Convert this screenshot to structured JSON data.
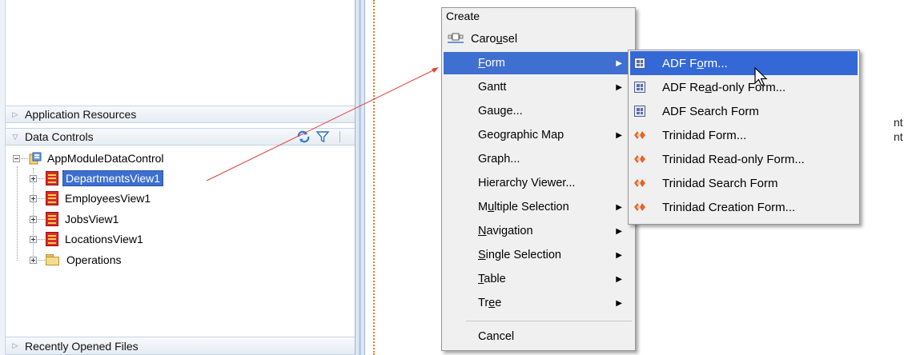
{
  "left_panel": {
    "accordions": {
      "application_resources": "Application Resources",
      "data_controls": "Data Controls",
      "recently_opened": "Recently Opened Files"
    },
    "tree": {
      "root": "AppModuleDataControl",
      "children": [
        {
          "label": "DepartmentsView1",
          "selected": true
        },
        {
          "label": "EmployeesView1"
        },
        {
          "label": "JobsView1"
        },
        {
          "label": "LocationsView1"
        },
        {
          "label": "Operations"
        }
      ]
    }
  },
  "background_text": {
    "line1": "nt on",
    "line2": "nt fron"
  },
  "create_menu": {
    "title": "Create",
    "items": [
      {
        "label": "Carousel"
      },
      {
        "label": "Form",
        "submenu": true,
        "active": true
      },
      {
        "label": "Gantt",
        "submenu": true
      },
      {
        "label": "Gauge..."
      },
      {
        "label": "Geographic Map",
        "submenu": true
      },
      {
        "label": "Graph..."
      },
      {
        "label": "Hierarchy Viewer..."
      },
      {
        "label": "Multiple Selection",
        "submenu": true
      },
      {
        "label": "Navigation",
        "submenu": true
      },
      {
        "label": "Single Selection",
        "submenu": true
      },
      {
        "label": "Table",
        "submenu": true
      },
      {
        "label": "Tree",
        "submenu": true
      },
      {
        "label": "Cancel"
      }
    ]
  },
  "form_submenu": {
    "items": [
      {
        "label": "ADF Form...",
        "icon": "adf-form-icon",
        "active": true
      },
      {
        "label": "ADF Read-only Form...",
        "icon": "adf-form-icon"
      },
      {
        "label": "ADF Search Form",
        "icon": "adf-form-icon"
      },
      {
        "label": "Trinidad Form...",
        "icon": "trinidad-icon"
      },
      {
        "label": "Trinidad Read-only Form...",
        "icon": "trinidad-icon"
      },
      {
        "label": "Trinidad Search Form",
        "icon": "trinidad-icon"
      },
      {
        "label": "Trinidad Creation Form...",
        "icon": "trinidad-icon"
      }
    ]
  },
  "colors": {
    "selection": "#3d6fcf",
    "menu_bg": "#f0f0f0",
    "drag_line": "#e0403a",
    "guide_line": "#e07a30"
  }
}
